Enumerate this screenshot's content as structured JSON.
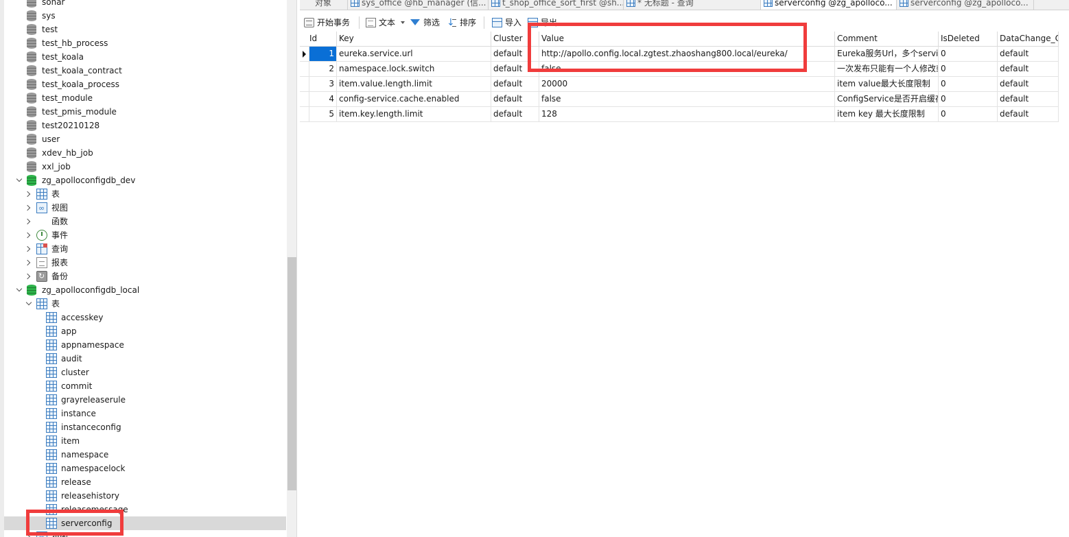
{
  "navigator": {
    "databases_top": [
      "sonar",
      "sys",
      "test",
      "test_hb_process",
      "test_koala",
      "test_koala_contract",
      "test_koala_process",
      "test_module",
      "test_pmis_module",
      "test20210128",
      "user",
      "xdev_hb_job",
      "xxl_job"
    ],
    "db_dev": {
      "name": "zg_apolloconfigdb_dev",
      "children": [
        "表",
        "视图",
        "函数",
        "事件",
        "查询",
        "报表",
        "备份"
      ]
    },
    "db_local": {
      "name": "zg_apolloconfigdb_local",
      "tables_label": "表",
      "tables": [
        "accesskey",
        "app",
        "appnamespace",
        "audit",
        "cluster",
        "commit",
        "grayreleaserule",
        "instance",
        "instanceconfig",
        "item",
        "namespace",
        "namespacelock",
        "release",
        "releasehistory",
        "releasemessage",
        "serverconfig"
      ],
      "after_tables": "视图"
    },
    "selected_table": "serverconfig"
  },
  "tabs": [
    {
      "label": "对象",
      "active": false
    },
    {
      "label": "sys_office @hb_manager (信...",
      "active": false
    },
    {
      "label": "t_shop_office_sort_first @sh...",
      "active": false
    },
    {
      "label": "* 无标题 - 查询",
      "active": false
    },
    {
      "label": "serverconfig @zg_apolloco...",
      "active": true
    },
    {
      "label": "serverconfig @zg_apolloco...",
      "active": false
    }
  ],
  "toolbar": {
    "begin_tx": "开始事务",
    "text": "文本",
    "filter": "筛选",
    "sort": "排序",
    "import": "导入",
    "export": "导出"
  },
  "grid": {
    "columns": [
      "Id",
      "Key",
      "Cluster",
      "Value",
      "Comment",
      "IsDeleted",
      "DataChange_C"
    ],
    "rows": [
      [
        "1",
        "eureka.service.url",
        "default",
        "http://apollo.config.local.zgtest.zhaoshang800.local/eureka/",
        "Eureka服务Url，多个servic",
        "0",
        "default"
      ],
      [
        "2",
        "namespace.lock.switch",
        "default",
        "false",
        "一次发布只能有一个人修改或",
        "0",
        "default"
      ],
      [
        "3",
        "item.value.length.limit",
        "default",
        "20000",
        "item value最大长度限制",
        "0",
        "default"
      ],
      [
        "4",
        "config-service.cache.enabled",
        "default",
        "false",
        "ConfigService是否开启缓存",
        "0",
        "default"
      ],
      [
        "5",
        "item.key.length.limit",
        "default",
        "128",
        "item key 最大长度限制",
        "0",
        "default"
      ]
    ],
    "selected_row": 1
  },
  "colors": {
    "highlight_box": "#f03c3c",
    "selection_blue": "#0a6fd6",
    "db_green": "#2db34a"
  }
}
